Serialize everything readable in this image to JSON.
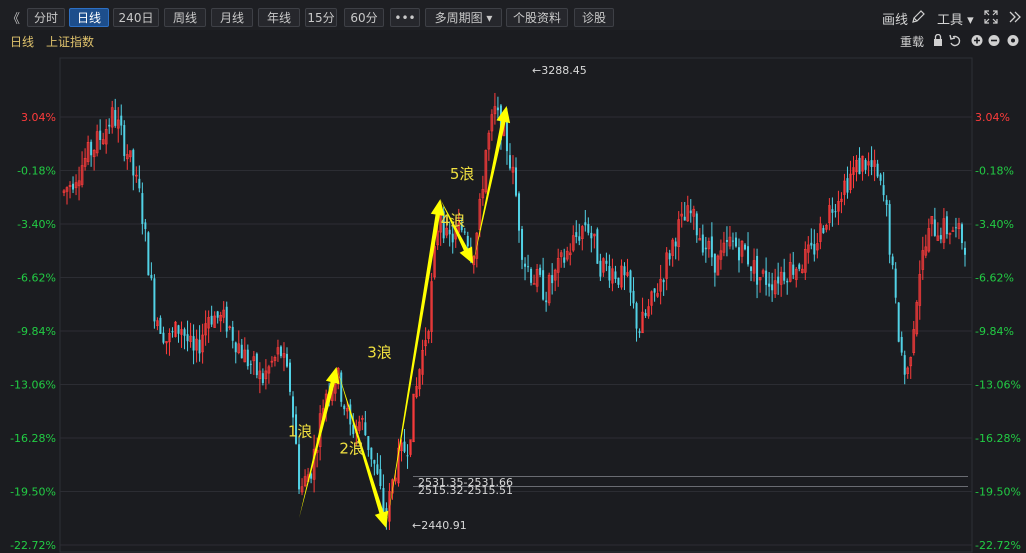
{
  "toolbar": {
    "collapse_glyph": "《",
    "buttons": [
      {
        "label": "分时"
      },
      {
        "label": "日线"
      },
      {
        "label": "240日"
      },
      {
        "label": "周线"
      },
      {
        "label": "月线"
      },
      {
        "label": "年线"
      },
      {
        "label": "15分"
      },
      {
        "label": "60分"
      },
      {
        "label": "•••"
      },
      {
        "label": "多周期图 ▾"
      },
      {
        "label": "个股资料"
      },
      {
        "label": "诊股"
      }
    ],
    "active_index": 1,
    "draw_label": "画线",
    "tools_label": "工具 ▾",
    "icons": [
      "pencil-icon",
      "fullscreen-icon",
      "collapse-right-icon"
    ]
  },
  "subbar": {
    "period": "日线",
    "name": "上证指数",
    "restore_label": "重载",
    "icons": [
      "lock-icon",
      "undo-icon",
      "zoom-in-icon",
      "zoom-out-icon",
      "settings-icon"
    ]
  },
  "colors": {
    "up": "#ff3c3c",
    "down": "#52d2e6",
    "arrow": "#ffff00",
    "pos_label": "#ff3c3c",
    "neg_label": "#22cc44",
    "grid": "#2c2d33"
  },
  "chart_data": {
    "type": "candlestick",
    "y_axis_ticks": [
      "3.04%",
      "-0.18%",
      "-3.40%",
      "-6.62%",
      "-9.84%",
      "-13.06%",
      "-16.28%",
      "-19.50%",
      "-22.72%"
    ],
    "ylim_pct": [
      -22.72,
      6.5
    ],
    "annotations": [
      {
        "text": "←3288.45",
        "kind": "high"
      },
      {
        "text": "←2440.91",
        "kind": "low"
      },
      {
        "text": "2531.35-2531.66",
        "kind": "level"
      },
      {
        "text": "2515.32-2515.51",
        "kind": "level"
      }
    ],
    "waves": [
      {
        "label": "1浪",
        "from": 0.2622,
        "to": 0.3032,
        "p_from": -21.1,
        "p_to": -12.0
      },
      {
        "label": "2浪",
        "from": 0.3032,
        "to": 0.3577,
        "p_from": -12.0,
        "p_to": -21.7
      },
      {
        "label": "3浪",
        "from": 0.3577,
        "to": 0.417,
        "p_from": -21.7,
        "p_to": -1.9
      },
      {
        "label": "4浪",
        "from": 0.417,
        "to": 0.4529,
        "p_from": -1.9,
        "p_to": -5.8
      },
      {
        "label": "5浪",
        "from": 0.4529,
        "to": 0.4897,
        "p_from": -5.8,
        "p_to": 3.7
      }
    ],
    "price_path": [
      [
        0.0,
        -1.5
      ],
      [
        0.02,
        0.2
      ],
      [
        0.04,
        1.8
      ],
      [
        0.055,
        3.2
      ],
      [
        0.07,
        1.0
      ],
      [
        0.085,
        -2.0
      ],
      [
        0.1,
        -8.5
      ],
      [
        0.115,
        -10.5
      ],
      [
        0.13,
        -9.5
      ],
      [
        0.145,
        -11.5
      ],
      [
        0.16,
        -8.8
      ],
      [
        0.18,
        -9.3
      ],
      [
        0.2,
        -11.3
      ],
      [
        0.22,
        -12.8
      ],
      [
        0.24,
        -11.0
      ],
      [
        0.252,
        -13.5
      ],
      [
        0.262,
        -19.5
      ],
      [
        0.275,
        -18.0
      ],
      [
        0.29,
        -13.5
      ],
      [
        0.303,
        -12.5
      ],
      [
        0.318,
        -15.8
      ],
      [
        0.33,
        -15.2
      ],
      [
        0.345,
        -18.0
      ],
      [
        0.357,
        -21.2
      ],
      [
        0.368,
        -18.0
      ],
      [
        0.382,
        -16.5
      ],
      [
        0.395,
        -12.0
      ],
      [
        0.405,
        -9.0
      ],
      [
        0.417,
        -2.2
      ],
      [
        0.425,
        -4.5
      ],
      [
        0.435,
        -4.0
      ],
      [
        0.445,
        -3.5
      ],
      [
        0.453,
        -5.3
      ],
      [
        0.46,
        -3.5
      ],
      [
        0.468,
        1.0
      ],
      [
        0.478,
        3.3
      ],
      [
        0.49,
        1.8
      ],
      [
        0.5,
        -1.0
      ],
      [
        0.51,
        -5.5
      ],
      [
        0.52,
        -6.5
      ],
      [
        0.535,
        -7.5
      ],
      [
        0.55,
        -6.0
      ],
      [
        0.565,
        -4.5
      ],
      [
        0.58,
        -3.2
      ],
      [
        0.595,
        -5.8
      ],
      [
        0.61,
        -6.2
      ],
      [
        0.625,
        -7.0
      ],
      [
        0.638,
        -9.8
      ],
      [
        0.65,
        -8.5
      ],
      [
        0.665,
        -6.3
      ],
      [
        0.68,
        -3.8
      ],
      [
        0.695,
        -2.8
      ],
      [
        0.71,
        -4.5
      ],
      [
        0.725,
        -5.8
      ],
      [
        0.74,
        -4.5
      ],
      [
        0.755,
        -5.0
      ],
      [
        0.77,
        -6.5
      ],
      [
        0.785,
        -6.8
      ],
      [
        0.8,
        -6.2
      ],
      [
        0.815,
        -5.8
      ],
      [
        0.83,
        -5.2
      ],
      [
        0.845,
        -3.0
      ],
      [
        0.86,
        -1.5
      ],
      [
        0.875,
        -0.3
      ],
      [
        0.888,
        0.4
      ],
      [
        0.9,
        -0.3
      ],
      [
        0.912,
        -2.2
      ],
      [
        0.925,
        -9.5
      ],
      [
        0.935,
        -13.0
      ],
      [
        0.95,
        -6.0
      ],
      [
        0.963,
        -3.5
      ],
      [
        0.975,
        -3.8
      ],
      [
        0.985,
        -3.6
      ],
      [
        1.0,
        -4.5
      ]
    ]
  }
}
